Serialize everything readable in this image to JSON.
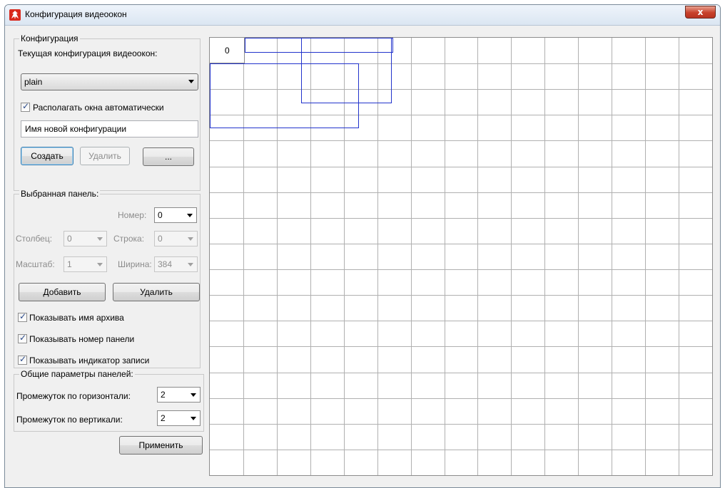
{
  "window": {
    "title": "Конфигурация видеоокон",
    "close_symbol": "x"
  },
  "config_group": {
    "legend": "Конфигурация",
    "current_label": "Текущая конфигурация видеоокон:",
    "current_value": "plain",
    "auto_arrange_label": "Располагать окна автоматически",
    "auto_arrange_checked": true,
    "new_name_value": "Имя новой конфигурации",
    "create_label": "Создать",
    "delete_label": "Удалить",
    "more_label": "..."
  },
  "panel_group": {
    "legend": "Выбранная панель:",
    "number_label": "Номер:",
    "number_value": "0",
    "column_label": "Столбец:",
    "column_value": "0",
    "row_label": "Строка:",
    "row_value": "0",
    "scale_label": "Масштаб:",
    "scale_value": "1",
    "width_label": "Ширина:",
    "width_value": "384",
    "add_label": "Добавить",
    "remove_label": "Удалить",
    "show_archive_label": "Показывать имя архива",
    "show_number_label": "Показывать номер панели",
    "show_record_label": "Показывать индикатор записи"
  },
  "common_group": {
    "legend": "Общие параметры панелей:",
    "h_gap_label": "Промежуток по горизонтали:",
    "h_gap_value": "2",
    "v_gap_label": "Промежуток по вертикали:",
    "v_gap_value": "2"
  },
  "apply_label": "Применить",
  "grid": {
    "columns": 15,
    "rows": 17,
    "selected_cell_label": "0",
    "colors": {
      "line": "#b0b0b0",
      "panel_outline": "#2233cc"
    }
  }
}
